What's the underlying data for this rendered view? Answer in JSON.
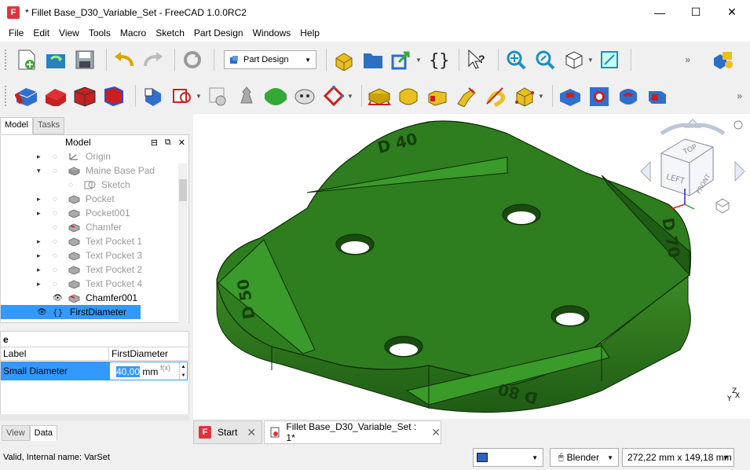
{
  "window": {
    "title": "* Fillet Base_D30_Variable_Set - FreeCAD 1.0.0RC2",
    "min": "—",
    "max": "☐",
    "close": "✕"
  },
  "menu": [
    "File",
    "Edit",
    "View",
    "Tools",
    "Macro",
    "Sketch",
    "Part Design",
    "Windows",
    "Help"
  ],
  "toolbar": {
    "workbench": "Part Design",
    "overflow": "»"
  },
  "panel": {
    "tabs": [
      "Model",
      "Tasks"
    ],
    "tree_header": "Model",
    "tree": [
      {
        "label": "Origin",
        "indent": 1,
        "expand": "▸",
        "icon": "origin-icon"
      },
      {
        "label": "Maine Base Pad",
        "indent": 1,
        "expand": "▾",
        "icon": "pad-icon"
      },
      {
        "label": "Sketch",
        "indent": 2,
        "expand": "",
        "icon": "sketch-icon"
      },
      {
        "label": "Pocket",
        "indent": 1,
        "expand": "▸",
        "icon": "pocket-icon"
      },
      {
        "label": "Pocket001",
        "indent": 1,
        "expand": "▸",
        "icon": "pocket-icon"
      },
      {
        "label": "Chamfer",
        "indent": 1,
        "expand": "",
        "icon": "chamfer-icon"
      },
      {
        "label": "Text Pocket 1",
        "indent": 1,
        "expand": "▸",
        "icon": "pocket-icon"
      },
      {
        "label": "Text Pocket 3",
        "indent": 1,
        "expand": "▸",
        "icon": "pocket-icon"
      },
      {
        "label": "Text Pocket 2",
        "indent": 1,
        "expand": "▸",
        "icon": "pocket-icon"
      },
      {
        "label": "Text Pocket 4",
        "indent": 1,
        "expand": "▸",
        "icon": "pocket-icon"
      },
      {
        "label": "Chamfer001",
        "indent": 1,
        "expand": "",
        "icon": "chamfer-icon"
      },
      {
        "label": "FirstDiameter",
        "indent": 0,
        "expand": "",
        "icon": "varset-icon"
      }
    ],
    "property": {
      "section": "e",
      "col_label": "Label",
      "col_value": "FirstDiameter",
      "name": "Small Diameter",
      "value": "40,00",
      "unit": "mm",
      "expr": "f(x)"
    },
    "bottom_tabs": [
      "View",
      "Data"
    ]
  },
  "view3d": {
    "engravings": [
      "D 40",
      "D 70",
      "D 50",
      "D 80"
    ],
    "navcube": {
      "top": "TOP",
      "left": "LEFT",
      "front": "FRONT"
    },
    "axis": {
      "x": "X",
      "y": "Y",
      "z": "Z"
    }
  },
  "doc_tabs": [
    {
      "label": "Start"
    },
    {
      "label": "Fillet Base_D30_Variable_Set : 1*"
    }
  ],
  "status": {
    "text": "Valid, Internal name: VarSet",
    "nav_style": "Blender",
    "dimensions": "272,22 mm x 149,18 mm"
  },
  "colors": {
    "part_green": "#2e7d1e",
    "selection": "#3399ff"
  }
}
